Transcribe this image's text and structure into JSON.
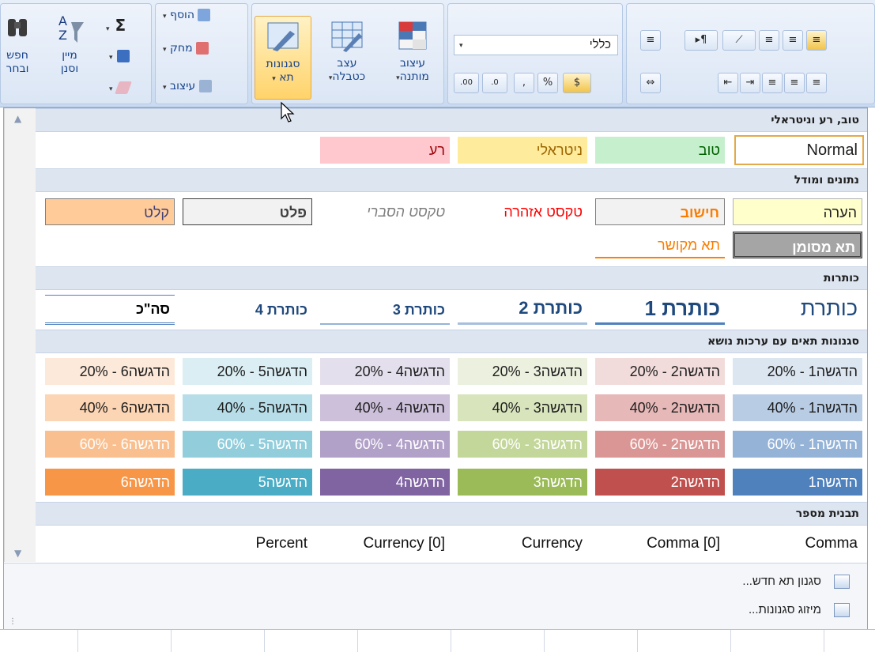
{
  "ribbon": {
    "find_label_1": "חפש",
    "find_label_2": "ובחר",
    "sort_label_1": "מיין",
    "sort_label_2": "וסנן",
    "sigma": "Σ",
    "insert_label": "הוסף",
    "delete_label": "מחק",
    "format_label": "עיצוב",
    "cell_styles_1": "סגנונות",
    "cell_styles_2": "תא",
    "format_table_1": "עצב",
    "format_table_2": "כטבלה",
    "cond_format_1": "עיצוב",
    "cond_format_2": "מותנה",
    "number_format_value": "כללי",
    "percent_symbol": "%",
    "comma_symbol": ","
  },
  "gallery": {
    "sections": [
      "טוב, רע וניטראלי",
      "נתונים ומודל",
      "כותרות",
      "סגנונות תאים עם ערכות נושא",
      "תבנית מספר"
    ],
    "good_bad": [
      "Normal",
      "טוב",
      "ניטראלי",
      "רע"
    ],
    "data_model_row1": [
      "הערה",
      "חישוב",
      "טקסט אזהרה",
      "טקסט הסברי",
      "פלט",
      "קלט"
    ],
    "data_model_row2": [
      "תא מסומן",
      "תא מקושר"
    ],
    "titles": [
      "כותרת",
      "כותרת 1",
      "כותרת 2",
      "כותרת 3",
      "כותרת 4",
      "סה\"כ"
    ],
    "accent20": [
      "הדגשה1 - 20%",
      "הדגשה2 - 20%",
      "הדגשה3 - 20%",
      "הדגשה4 - 20%",
      "הדגשה5 - 20%",
      "הדגשה6 - 20%"
    ],
    "accent40": [
      "הדגשה1 - 40%",
      "הדגשה2 - 40%",
      "הדגשה3 - 40%",
      "הדגשה4 - 40%",
      "הדגשה5 - 40%",
      "הדגשה6 - 40%"
    ],
    "accent60": [
      "הדגשה1 - 60%",
      "הדגשה2 - 60%",
      "הדגשה3 - 60%",
      "הדגשה4 - 60%",
      "הדגשה5 - 60%",
      "הדגשה6 - 60%"
    ],
    "accent": [
      "הדגשה1",
      "הדגשה2",
      "הדגשה3",
      "הדגשה4",
      "הדגשה5",
      "הדגשה6"
    ],
    "number_formats": [
      "Comma",
      "Comma [0]",
      "Currency",
      "Currency [0]",
      "Percent"
    ],
    "footer_new": "סגנון תא חדש...",
    "footer_merge": "מיזוג סגנונות..."
  },
  "colors": {
    "good_bg": "#c6efce",
    "good_fg": "#006100",
    "neutral_bg": "#ffeb9c",
    "neutral_fg": "#9c6500",
    "bad_bg": "#ffc7ce",
    "bad_fg": "#9c0006",
    "note_bg": "#ffffcc",
    "calc_bg": "#f2f2f2",
    "calc_fg": "#fa7d00",
    "input_bg": "#ffcc99",
    "input_fg": "#3f3f76",
    "title_fg": "#1f497d",
    "accent1": "#4f81bd",
    "accent2": "#c0504d",
    "accent3": "#9bbb59",
    "accent4": "#8064a2",
    "accent5": "#4bacc6",
    "accent6": "#f79646"
  }
}
